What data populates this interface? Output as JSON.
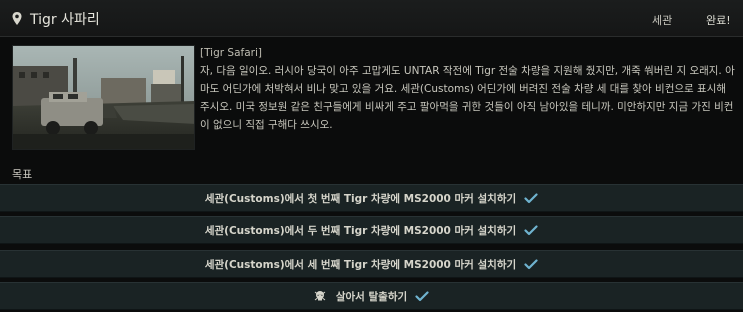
{
  "header": {
    "title": "Tigr 사파리",
    "location": "세관",
    "status": "완료!"
  },
  "quest": {
    "codename": "[Tigr Safari]",
    "description": "자, 다음 일이오. 러시아 당국이 아주 고맙게도 UNTAR 작전에 Tigr 전술 차량을 지원해 줬지만, 개죽 쒀버린 지 오래지. 아마도 어딘가에 처박혀서 비나 맞고 있을 거요. 세관(Customs) 어딘가에 버려진 전술 차량 세 대를 찾아 비컨으로 표시해 주시오. 미국 정보원 같은 친구들에게 비싸게 주고 팔아먹을 귀한 것들이 아직 남아있을 테니까. 미안하지만 지금 가진 비컨이 없으니 직접 구해다 쓰시오."
  },
  "objectives": {
    "heading": "목표",
    "items": [
      {
        "label": "세관(Customs)에서 첫 번째 Tigr 차량에 MS2000 마커 설치하기",
        "completed": true
      },
      {
        "label": "세관(Customs)에서 두 번째 Tigr 차량에 MS2000 마커 설치하기",
        "completed": true
      },
      {
        "label": "세관(Customs)에서 세 번째 Tigr 차량에 MS2000 마커 설치하기",
        "completed": true
      },
      {
        "label": "살아서 탈출하기",
        "completed": true,
        "icon": "skull-icon"
      }
    ]
  },
  "colors": {
    "check": "#6fb3cf",
    "objective_bg": "#1a2324"
  }
}
